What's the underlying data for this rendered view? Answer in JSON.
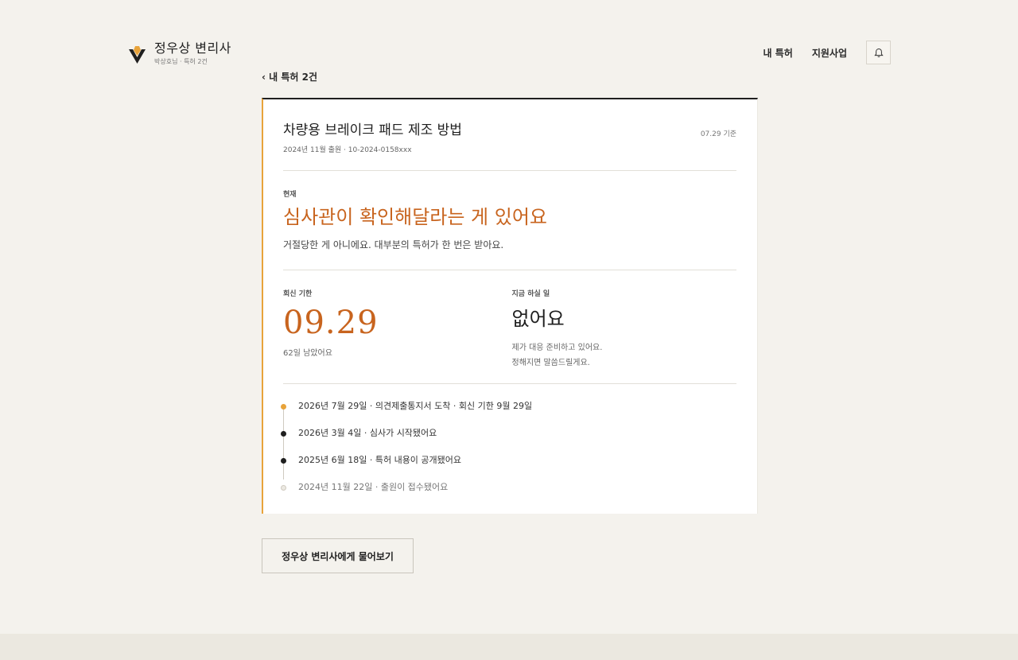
{
  "brand": {
    "name": "정우상 변리사",
    "subtitle": "박상호님 · 특허 2건"
  },
  "nav": {
    "my_patents": "내 특허",
    "support_programs": "지원사업"
  },
  "back_link": "‹ 내 특허 2건",
  "patent": {
    "title": "차량용 브레이크 패드 제조 방법",
    "meta": "2024년 11월 출원 · 10-2024-0158xxx",
    "as_of": "07.29 기준"
  },
  "status": {
    "label": "현재",
    "headline": "심사관이 확인해달라는 게 있어요",
    "description": "거절당한 게 아니에요. 대부분의 특허가 한 번은 받아요."
  },
  "deadline": {
    "label": "회신 기한",
    "value": "09.29",
    "remaining": "62일 남았어요"
  },
  "todo": {
    "label": "지금 하실 일",
    "value": "없어요",
    "line1": "제가 대응 준비하고 있어요.",
    "line2": "정해지면 말씀드릴게요."
  },
  "timeline": [
    {
      "text": "2026년 7월 29일 · 의견제출통지서 도착 · 회신 기한 9월 29일",
      "state": "active"
    },
    {
      "text": "2026년 3월 4일 · 심사가 시작됐어요",
      "state": "done"
    },
    {
      "text": "2025년 6월 18일 · 특허 내용이 공개됐어요",
      "state": "done"
    },
    {
      "text": "2024년 11월 22일 · 출원이 접수됐어요",
      "state": "future"
    }
  ],
  "ask_button": "정우상 변리사에게 물어보기",
  "colors": {
    "accent": "#c8641e",
    "gold": "#e8a33a",
    "background": "#f4f2ed"
  }
}
